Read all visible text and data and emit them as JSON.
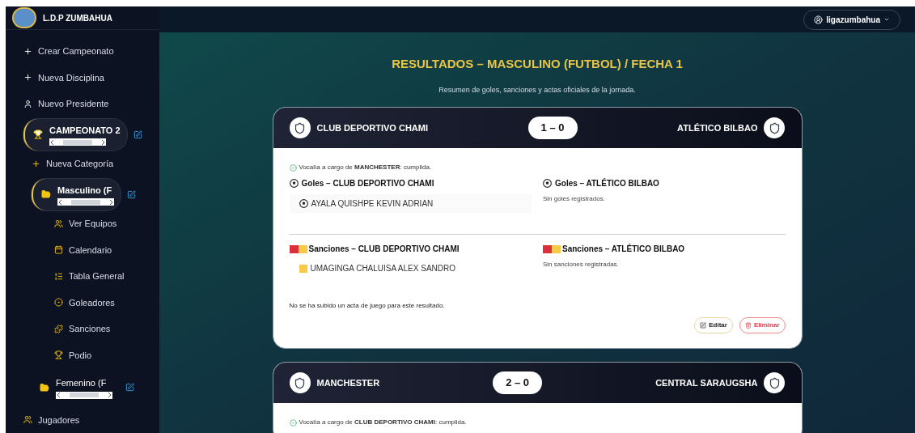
{
  "brand": {
    "name": "L.D.P ZUMBAHUA"
  },
  "user_menu": {
    "label": "ligazumbahua"
  },
  "sidebar": {
    "items": [
      {
        "kind": "add",
        "label": "Crear Campeonato"
      },
      {
        "kind": "add",
        "label": "Nueva Disciplina"
      },
      {
        "kind": "person",
        "label": "Nuevo Presidente"
      },
      {
        "kind": "championship",
        "label": "CAMPEONATO 2",
        "selected": true,
        "children": [
          {
            "kind": "add",
            "label": "Nueva Categoría"
          },
          {
            "kind": "category",
            "label": "Masculino (F",
            "selected": true,
            "children": [
              {
                "kind": "teams",
                "label": "Ver Equipos"
              },
              {
                "kind": "calendar",
                "label": "Calendario"
              },
              {
                "kind": "table",
                "label": "Tabla General"
              },
              {
                "kind": "scorers",
                "label": "Goleadores"
              },
              {
                "kind": "sanctions",
                "label": "Sanciones"
              },
              {
                "kind": "podium",
                "label": "Podio"
              }
            ]
          },
          {
            "kind": "category",
            "label": "Femenino (F",
            "selected": false
          }
        ]
      },
      {
        "kind": "players",
        "label": "Jugadores"
      }
    ]
  },
  "page": {
    "title": "RESULTADOS – MASCULINO (FUTBOL) / FECHA 1",
    "subtitle": "Resumen de goles, sanciones y actas oficiales de la jornada."
  },
  "matches": [
    {
      "home": "CLUB DEPORTIVO CHAMI",
      "away": "ATLÉTICO BILBAO",
      "score": "1 – 0",
      "vocalia": "Vocalía a cargo de **MANCHESTER**: cumplida.",
      "goals": [
        {
          "title": "Goles – CLUB DEPORTIVO CHAMI",
          "players": [
            "AYALA QUISHPE KEVIN ADRIAN"
          ]
        },
        {
          "title": "Goles – ATLÉTICO BILBAO",
          "empty": "Sin goles registrados."
        }
      ],
      "sanctions": [
        {
          "title": "Sanciones – CLUB DEPORTIVO CHAMI",
          "players": [
            {
              "name": "UMAGINGA CHALUISA ALEX SANDRO",
              "color": "#f7c948"
            }
          ]
        },
        {
          "title": "Sanciones – ATLÉTICO BILBAO",
          "empty": "Sin sanciones registradas."
        }
      ],
      "acta": "No se ha subido un acta de juego para este resultado.",
      "actions": [
        "Editar",
        "Eliminar"
      ]
    },
    {
      "home": "MANCHESTER",
      "away": "CENTRAL SARAUGSHA",
      "score": "2 – 0",
      "vocalia": "Vocalía a cargo de **CLUB DEPORTIVO CHAMI**: cumplida."
    }
  ]
}
